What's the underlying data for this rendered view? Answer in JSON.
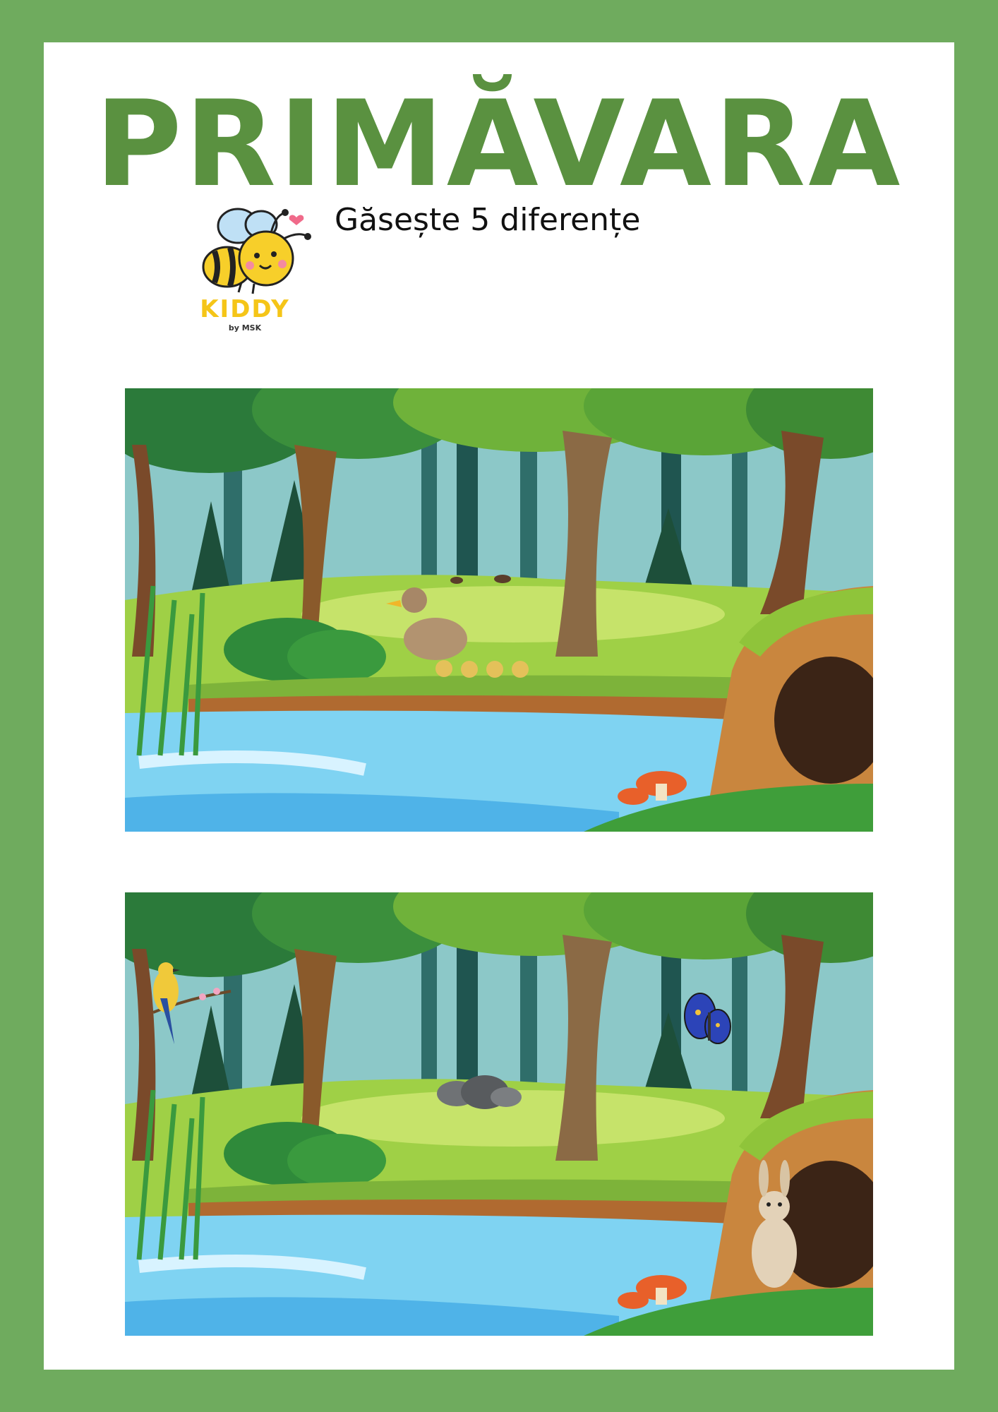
{
  "page": {
    "title": "PRIMĂVARA",
    "subtitle": "Găsește 5 diferențe"
  },
  "logo": {
    "brand": "KIDDY",
    "byline": "by MSK",
    "icon": "bee-icon"
  },
  "colors": {
    "border": "#6fab5e",
    "title": "#5a9140",
    "logo_yellow": "#f5c518"
  },
  "scenes": [
    {
      "name": "original",
      "extras": [
        "duck-with-ducklings",
        "small-beetles"
      ]
    },
    {
      "name": "modified",
      "extras": [
        "yellow-bird-on-branch",
        "blue-butterfly",
        "grey-rocks",
        "rabbit"
      ]
    }
  ]
}
